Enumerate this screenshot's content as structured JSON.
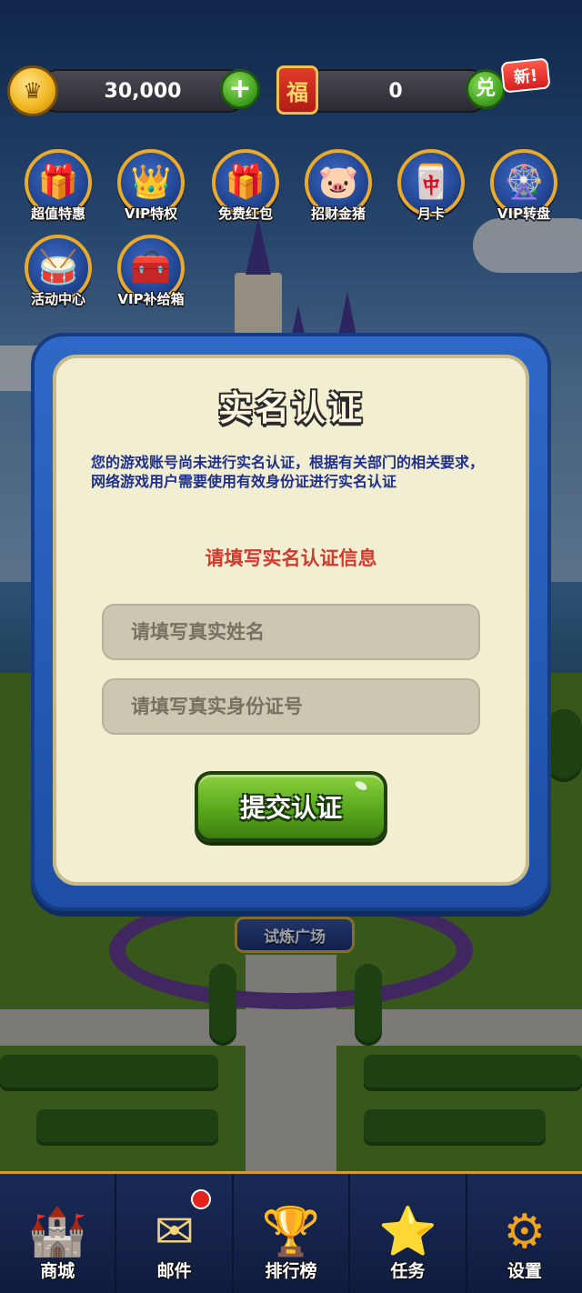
{
  "currency": {
    "coins": "30,000",
    "fu_amount": "0",
    "fu_icon_text": "福",
    "exchange_text": "兑",
    "new_badge": "新!",
    "plus_text": "+"
  },
  "features": [
    {
      "label": "超值特惠",
      "icon": "gift-box-icon",
      "glyph": "🎁"
    },
    {
      "label": "VIP特权",
      "icon": "crown-icon",
      "glyph": "👑"
    },
    {
      "label": "免费红包",
      "icon": "gift-box-icon",
      "glyph": "🎁"
    },
    {
      "label": "招财金猪",
      "icon": "piggy-bank-icon",
      "glyph": "🐷"
    },
    {
      "label": "月卡",
      "icon": "month-card-icon",
      "glyph": "🀄"
    },
    {
      "label": "VIP转盘",
      "icon": "wheel-icon",
      "glyph": "🎡"
    },
    {
      "label": "活动中心",
      "icon": "drum-icon",
      "glyph": "🥁"
    },
    {
      "label": "VIP补给箱",
      "icon": "chest-icon",
      "glyph": "🧰"
    }
  ],
  "plaza_sign": "试炼广场",
  "dialog": {
    "title": "实名认证",
    "description": "您的游戏账号尚未进行实名认证，根据有关部门的相关要求，网络游戏用户需要使用有效身份证进行实名认证",
    "prompt": "请填写实名认证信息",
    "name_placeholder": "请填写真实姓名",
    "name_value": "",
    "id_placeholder": "请填写真实身份证号",
    "id_value": "",
    "submit_label": "提交认证"
  },
  "bottom_nav": [
    {
      "label": "商城",
      "icon": "castle-icon",
      "glyph": "🏰"
    },
    {
      "label": "邮件",
      "icon": "mail-icon",
      "glyph": "✉"
    },
    {
      "label": "排行榜",
      "icon": "trophy-icon",
      "glyph": "🏆"
    },
    {
      "label": "任务",
      "icon": "task-book-icon",
      "glyph": "⭐"
    },
    {
      "label": "设置",
      "icon": "gear-icon",
      "glyph": "⚙"
    }
  ]
}
